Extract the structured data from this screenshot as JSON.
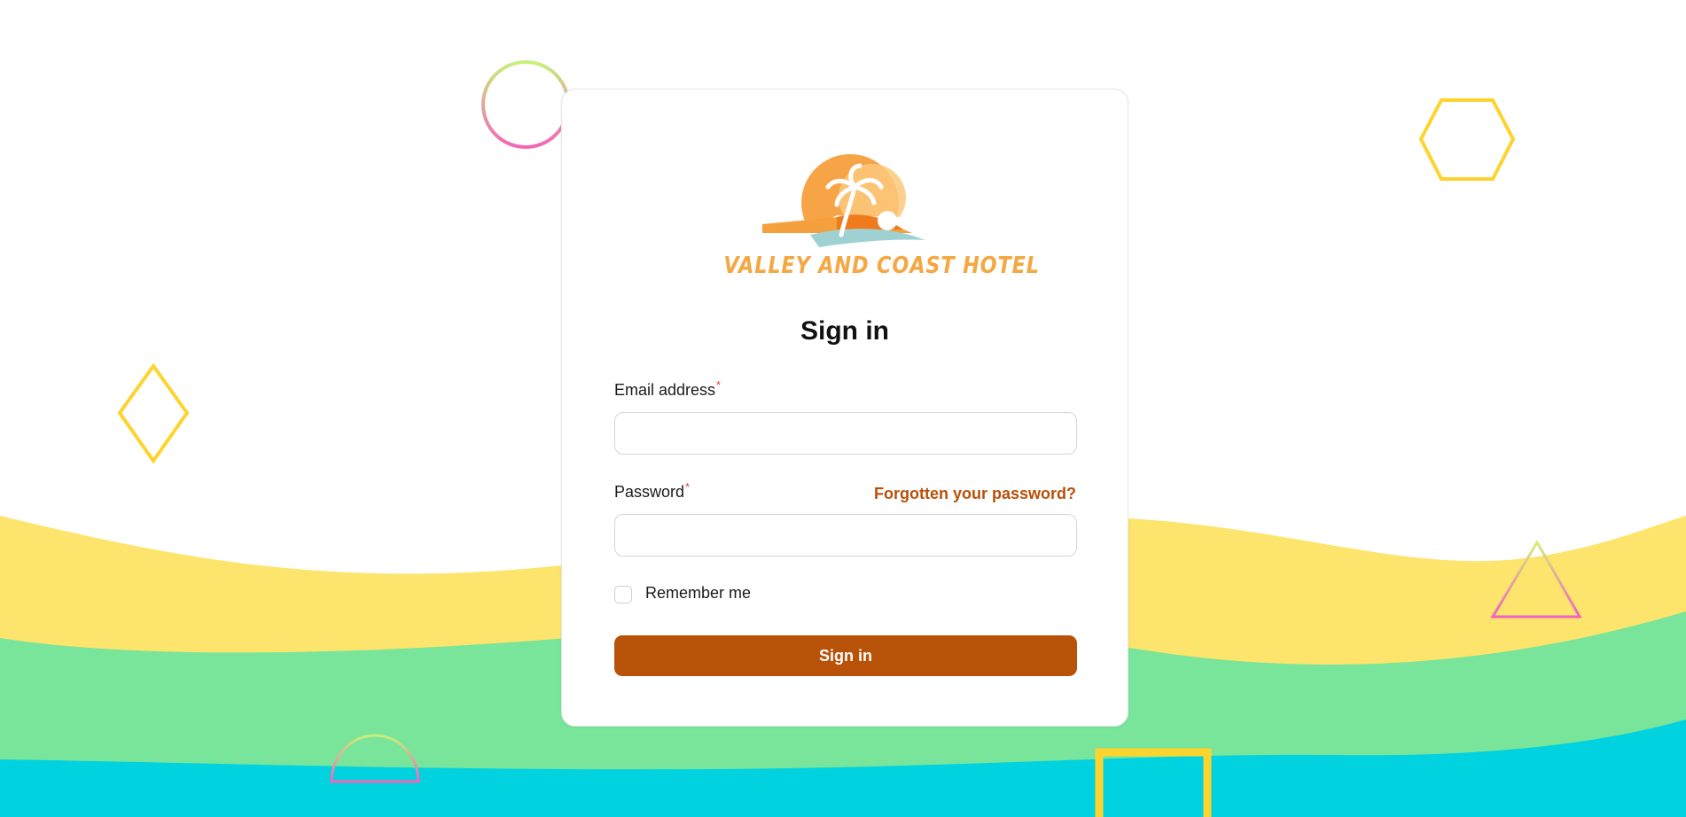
{
  "brand": {
    "name": "VALLEY AND COAST HOTEL"
  },
  "form": {
    "title": "Sign in",
    "email_label": "Email address",
    "email_value": "",
    "password_label": "Password",
    "password_value": "",
    "required_mark": "*",
    "forgot_link": "Forgotten your password?",
    "remember_label": "Remember me",
    "remember_checked": false,
    "submit_label": "Sign in"
  },
  "colors": {
    "accent": "#b75208",
    "link": "#b75008",
    "required": "#e53e3e",
    "wave_yellow": "#fde46c",
    "wave_green": "#78e59b",
    "wave_cyan": "#00d2e0",
    "logo_orange": "#f5a742"
  },
  "icons": {
    "logo": "palm-tree-sunset-logo",
    "decorations": [
      "circle-outline",
      "hexagon-outline",
      "diamond-outline",
      "triangle-outline",
      "semicircle-outline",
      "square-outline"
    ]
  }
}
